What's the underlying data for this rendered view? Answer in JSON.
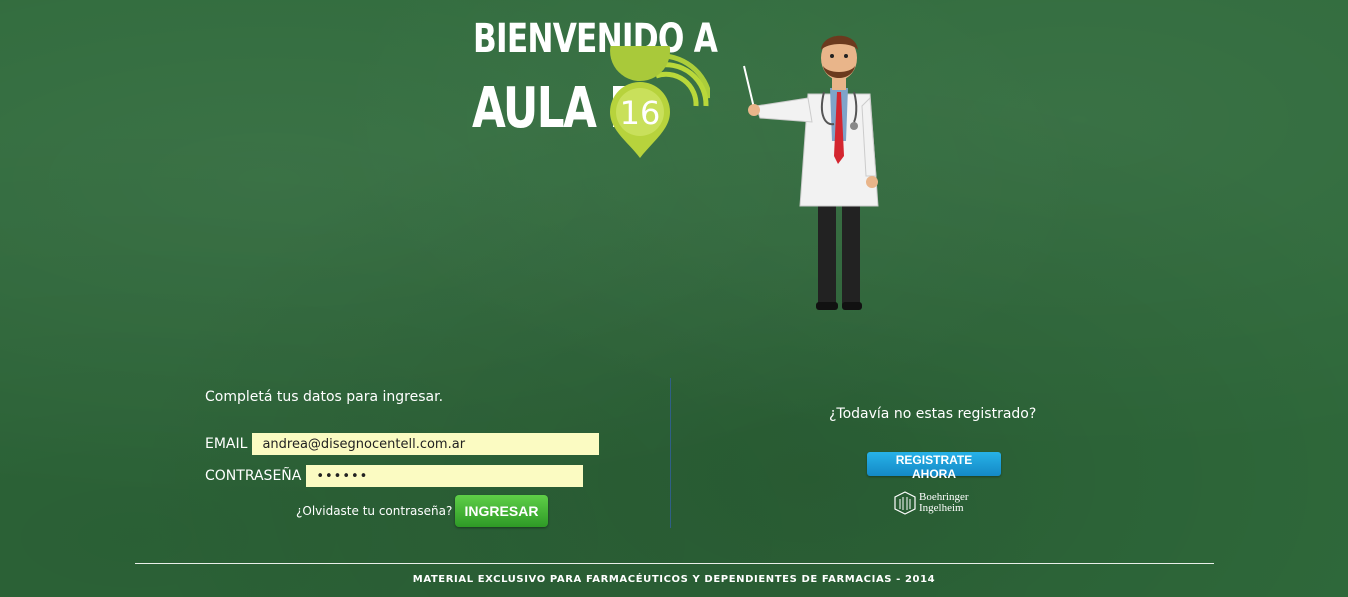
{
  "header": {
    "welcome": "BIENVENIDO A",
    "brand": "AULA BI",
    "brand_number": "16"
  },
  "login": {
    "intro": "Completá tus datos para ingresar.",
    "email_label": "EMAIL",
    "email_value": "andrea@disegnocentell.com.ar",
    "password_label": "CONTRASEÑA",
    "password_value": "••••••",
    "forgot_link": "¿Olvidaste tu contraseña?",
    "submit_label": "INGRESAR"
  },
  "register": {
    "prompt": "¿Todavía no estas registrado?",
    "button_label": "REGISTRATE AHORA"
  },
  "sponsor": {
    "line1": "Boehringer",
    "line2": "Ingelheim"
  },
  "footer": {
    "text": "MATERIAL EXCLUSIVO PARA FARMACÉUTICOS Y DEPENDIENTES DE FARMACIAS - 2014"
  },
  "colors": {
    "background": "#2f6a3b",
    "accent_green": "#4bbd3a",
    "accent_blue": "#1ea0db",
    "input_bg": "#fbfbc2"
  }
}
